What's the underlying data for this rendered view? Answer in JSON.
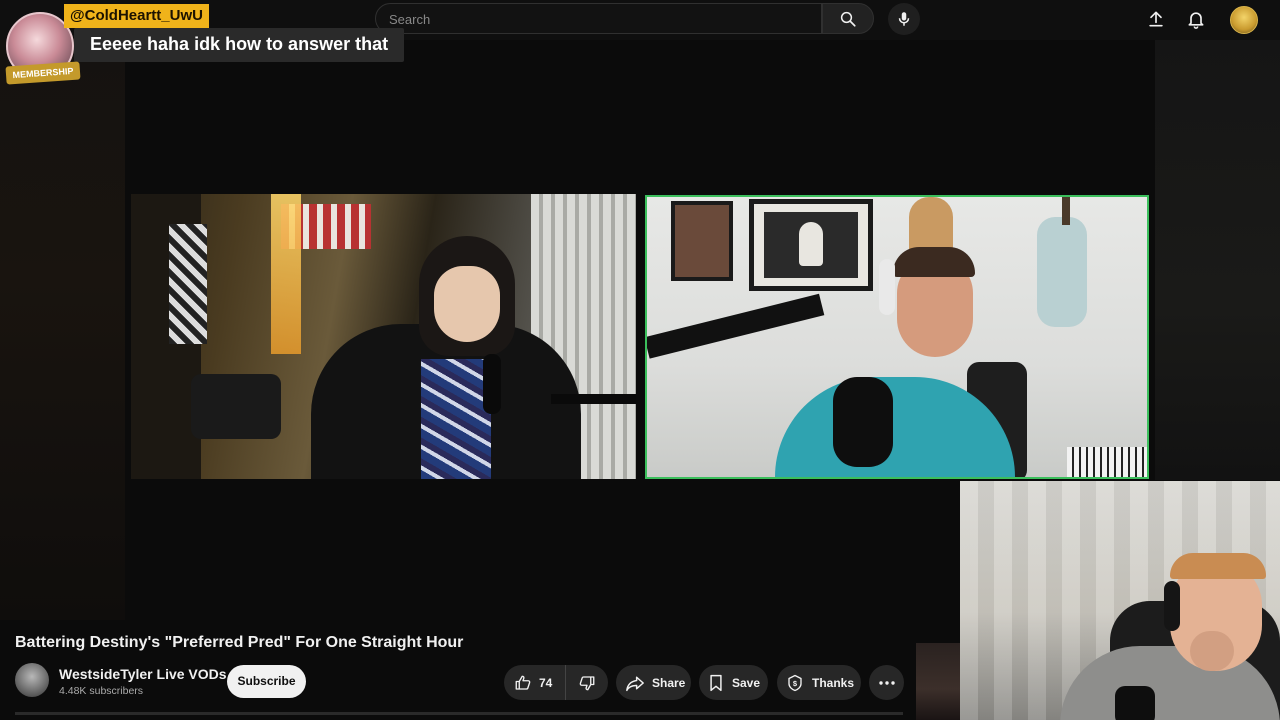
{
  "header": {
    "search_placeholder": "Search",
    "icons": [
      "search-icon",
      "microphone-icon",
      "upload-icon",
      "notification-bell-icon",
      "user-avatar"
    ]
  },
  "chat_overlay": {
    "username": "@ColdHeartt_UwU",
    "badge": "MEMBERSHIP",
    "message": "Eeeee haha idk how to answer that"
  },
  "video": {
    "title": "Battering Destiny's \"Preferred Pred\" For One Straight Hour",
    "active_speaker_border_color": "#3bbf5c"
  },
  "channel": {
    "name": "WestsideTyler Live VODs",
    "subscribers": "4.48K subscribers",
    "subscribe_label": "Subscribe"
  },
  "actions": {
    "like_count": "74",
    "share_label": "Share",
    "save_label": "Save",
    "thanks_label": "Thanks"
  }
}
